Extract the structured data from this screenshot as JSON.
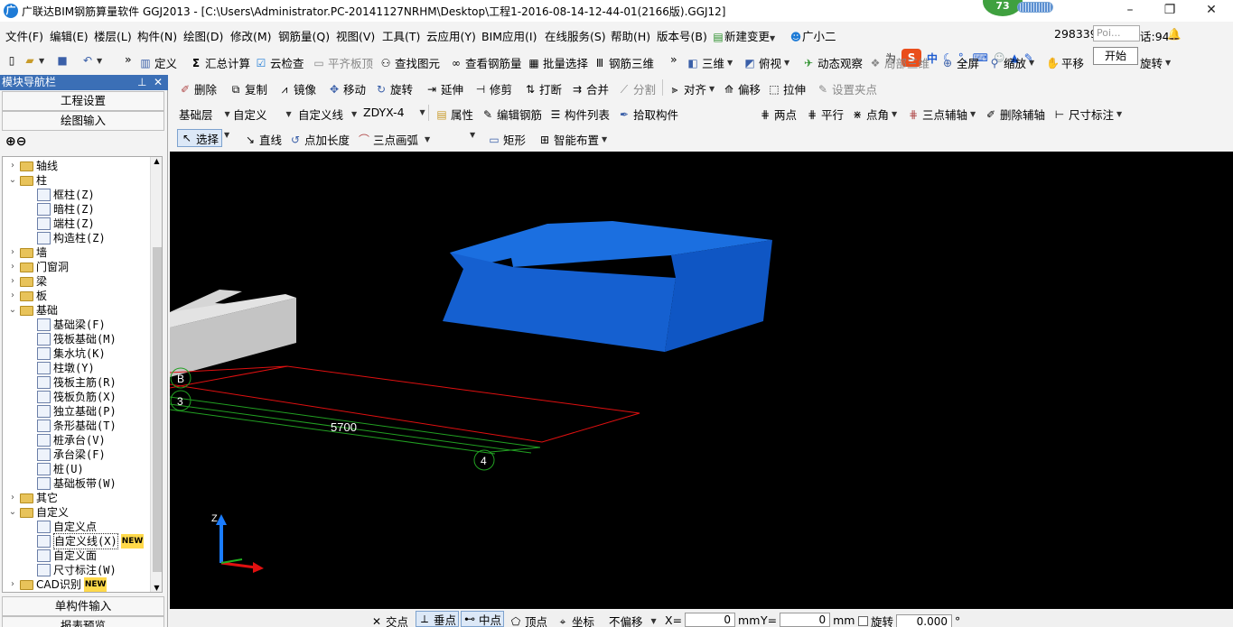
{
  "title": {
    "text": "广联达BIM钢筋算量软件 GGJ2013 - [C:\\Users\\Administrator.PC-20141127NRHM\\Desktop\\工程1-2016-08-14-12-44-01(2166版).GGJ12]",
    "perf_value": "73"
  },
  "menu": [
    "文件(F)",
    "编辑(E)",
    "楼层(L)",
    "构件(N)",
    "绘图(D)",
    "修改(M)",
    "钢筋量(Q)",
    "视图(V)",
    "工具(T)",
    "云应用(Y)",
    "BIM应用(I)",
    "在线服务(S)",
    "帮助(H)",
    "版本号(B)",
    "新建变更",
    "广小二"
  ],
  "menu_right": {
    "text_a": "为",
    "ime_cn": "中",
    "text_phone": "298339",
    "search_placeholder": "Poi...",
    "text_b": "话:94"
  },
  "tooltip": "开始",
  "toolbar1": {
    "define": "定义",
    "sum": "汇总计算",
    "cloud_check": "云检查",
    "level_top": "平齐板顶",
    "find": "查找图元",
    "view_rebar": "查看钢筋量",
    "batch": "批量选择",
    "rebar3d": "钢筋三维",
    "view3d": "三维",
    "top_view": "俯视",
    "dynamic": "动态观察",
    "local3d": "局部三维",
    "fullscreen": "全屏",
    "zoom": "缩放",
    "pan": "平移",
    "rotate": "旋转"
  },
  "toolbar2": {
    "delete": "删除",
    "copy": "复制",
    "mirror": "镜像",
    "move": "移动",
    "rotate": "旋转",
    "extend": "延伸",
    "trim": "修剪",
    "break": "打断",
    "merge": "合并",
    "split": "分割",
    "align": "对齐",
    "offset": "偏移",
    "stretch": "拉伸",
    "grip": "设置夹点"
  },
  "toolbar3": {
    "layer": "基础层",
    "category": "自定义",
    "type": "自定义线",
    "component": "ZDYX-4",
    "props": "属性",
    "edit_rebar": "编辑钢筋",
    "comp_list": "构件列表",
    "pick": "拾取构件",
    "two_point": "两点",
    "parallel": "平行",
    "point_angle": "点角",
    "three_axis": "三点辅轴",
    "del_axis": "删除辅轴",
    "dimension": "尺寸标注"
  },
  "toolbar4": {
    "select": "选择",
    "line": "直线",
    "point_len": "点加长度",
    "arc": "三点画弧",
    "rect": "矩形",
    "smart": "智能布置"
  },
  "nav": {
    "header": "模块导航栏",
    "btn_project": "工程设置",
    "btn_draw": "绘图输入",
    "btn_single": "单构件输入",
    "btn_report": "报表预览",
    "tree": [
      {
        "label": "轴线",
        "level": 0,
        "exp": "›"
      },
      {
        "label": "柱",
        "level": 0,
        "exp": "⌄"
      },
      {
        "label": "框柱(Z)",
        "level": 1
      },
      {
        "label": "暗柱(Z)",
        "level": 1
      },
      {
        "label": "端柱(Z)",
        "level": 1
      },
      {
        "label": "构造柱(Z)",
        "level": 1
      },
      {
        "label": "墙",
        "level": 0,
        "exp": "›"
      },
      {
        "label": "门窗洞",
        "level": 0,
        "exp": "›"
      },
      {
        "label": "梁",
        "level": 0,
        "exp": "›"
      },
      {
        "label": "板",
        "level": 0,
        "exp": "›"
      },
      {
        "label": "基础",
        "level": 0,
        "exp": "⌄"
      },
      {
        "label": "基础梁(F)",
        "level": 1
      },
      {
        "label": "筏板基础(M)",
        "level": 1
      },
      {
        "label": "集水坑(K)",
        "level": 1
      },
      {
        "label": "柱墩(Y)",
        "level": 1
      },
      {
        "label": "筏板主筋(R)",
        "level": 1
      },
      {
        "label": "筏板负筋(X)",
        "level": 1
      },
      {
        "label": "独立基础(P)",
        "level": 1
      },
      {
        "label": "条形基础(T)",
        "level": 1
      },
      {
        "label": "桩承台(V)",
        "level": 1
      },
      {
        "label": "承台梁(F)",
        "level": 1
      },
      {
        "label": "桩(U)",
        "level": 1
      },
      {
        "label": "基础板带(W)",
        "level": 1
      },
      {
        "label": "其它",
        "level": 0,
        "exp": "›"
      },
      {
        "label": "自定义",
        "level": 0,
        "exp": "⌄"
      },
      {
        "label": "自定义点",
        "level": 1
      },
      {
        "label": "自定义线(X)",
        "level": 1,
        "badge": "NEW"
      },
      {
        "label": "自定义面",
        "level": 1
      },
      {
        "label": "尺寸标注(W)",
        "level": 1
      },
      {
        "label": "CAD识别",
        "level": 0,
        "exp": "›",
        "badge": "NEW"
      }
    ]
  },
  "viewport": {
    "dim_label": "5700",
    "axis_b": "B",
    "axis_3": "3",
    "axis_4": "4",
    "axis_z": "Z"
  },
  "status": {
    "intersect": "交点",
    "perp": "垂点",
    "mid": "中点",
    "vertex": "顶点",
    "coord": "坐标",
    "offset_mode": "不偏移",
    "x_label": "X=",
    "x_val": "0",
    "mm": "mm",
    "y_label": "Y=",
    "y_val": "0",
    "rotate": "旋转",
    "rot_val": "0.000",
    "deg": "°"
  },
  "colors": {
    "nav_header": "#3b6fb6",
    "viewport_bg": "#000000",
    "block_blue": "#1565d8",
    "axis_red": "#e01010",
    "axis_green": "#20a020"
  }
}
